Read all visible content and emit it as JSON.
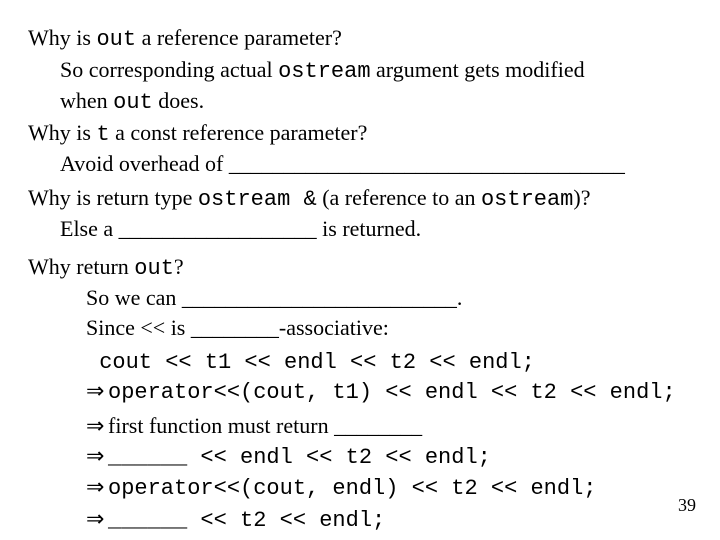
{
  "q1": {
    "question_pre": "Why is ",
    "code1": "out",
    "question_post": " a reference parameter?",
    "ans_l1_pre": "So corresponding actual ",
    "ans_l1_code": "ostream",
    "ans_l1_post": " argument gets modified",
    "ans_l2_pre": "when ",
    "ans_l2_code": "out",
    "ans_l2_post": " does."
  },
  "q2": {
    "question_pre": "Why is ",
    "code1": "t",
    "question_post": " a const reference parameter?",
    "ans": "Avoid overhead of ____________________________________"
  },
  "q3": {
    "question_pre": "Why is return type ",
    "code1": "ostream &",
    "question_mid": " (a reference to an ",
    "code2": "ostream",
    "question_post": ")?",
    "ans": "Else a __________________ is returned."
  },
  "q4": {
    "question_pre": "Why return ",
    "code1": "out",
    "question_post": "?",
    "ans1": "So we can _________________________.",
    "ans2": "Since << is ________-associative:"
  },
  "code": {
    "c1": " cout << t1 << endl << t2 << endl;",
    "c2a": "operator<<(cout, t1) << endl << t2 << endl;",
    "c3": "first function must return ________",
    "c4": "______ << endl << t2 << endl;",
    "c5": "operator<<(cout, endl) << t2 << endl;",
    "c6": "______ << t2 << endl;"
  },
  "arrow": "⇒",
  "pagenum": "39"
}
